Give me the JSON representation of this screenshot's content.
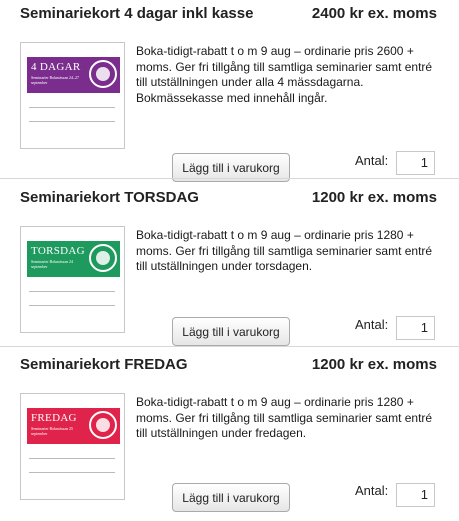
{
  "products": [
    {
      "title": "Seminariekort 4 dagar inkl kasse",
      "price": "2400 kr ex. moms",
      "description": "Boka-tidigt-rabatt t o m 9 aug – ordinarie pris 2600 + moms. Ger fri tillgång till samtliga seminarier samt entré till utställningen under alla 4 mässdagarna. Bokmässekasse med innehåll ingår.",
      "card_title": "4 DAGAR",
      "card_subtitle": "Seminarier Bokmässan 24–27 september",
      "card_color": "#7b2d8e",
      "button_label": "Lägg till i varukorg",
      "quantity_label": "Antal:",
      "quantity_value": "1"
    },
    {
      "title": "Seminariekort TORSDAG",
      "price": "1200 kr ex. moms",
      "description": "Boka-tidigt-rabatt t o m 9 aug – ordinarie pris 1280 + moms. Ger fri tillgång till samtliga seminarier samt entré till utställningen under torsdagen.",
      "card_title": "TORSDAG",
      "card_subtitle": "Seminarier Bokmässan 24 september",
      "card_color": "#1f9a5e",
      "button_label": "Lägg till i varukorg",
      "quantity_label": "Antal:",
      "quantity_value": "1"
    },
    {
      "title": "Seminariekort FREDAG",
      "price": "1200 kr ex. moms",
      "description": "Boka-tidigt-rabatt t o m 9 aug – ordinarie pris 1280 + moms. Ger fri tillgång till samtliga seminarier samt entré till utställningen under fredagen.",
      "card_title": "FREDAG",
      "card_subtitle": "Seminarier Bokmässan 25 september",
      "card_color": "#e0234a",
      "button_label": "Lägg till i varukorg",
      "quantity_label": "Antal:",
      "quantity_value": "1"
    }
  ]
}
